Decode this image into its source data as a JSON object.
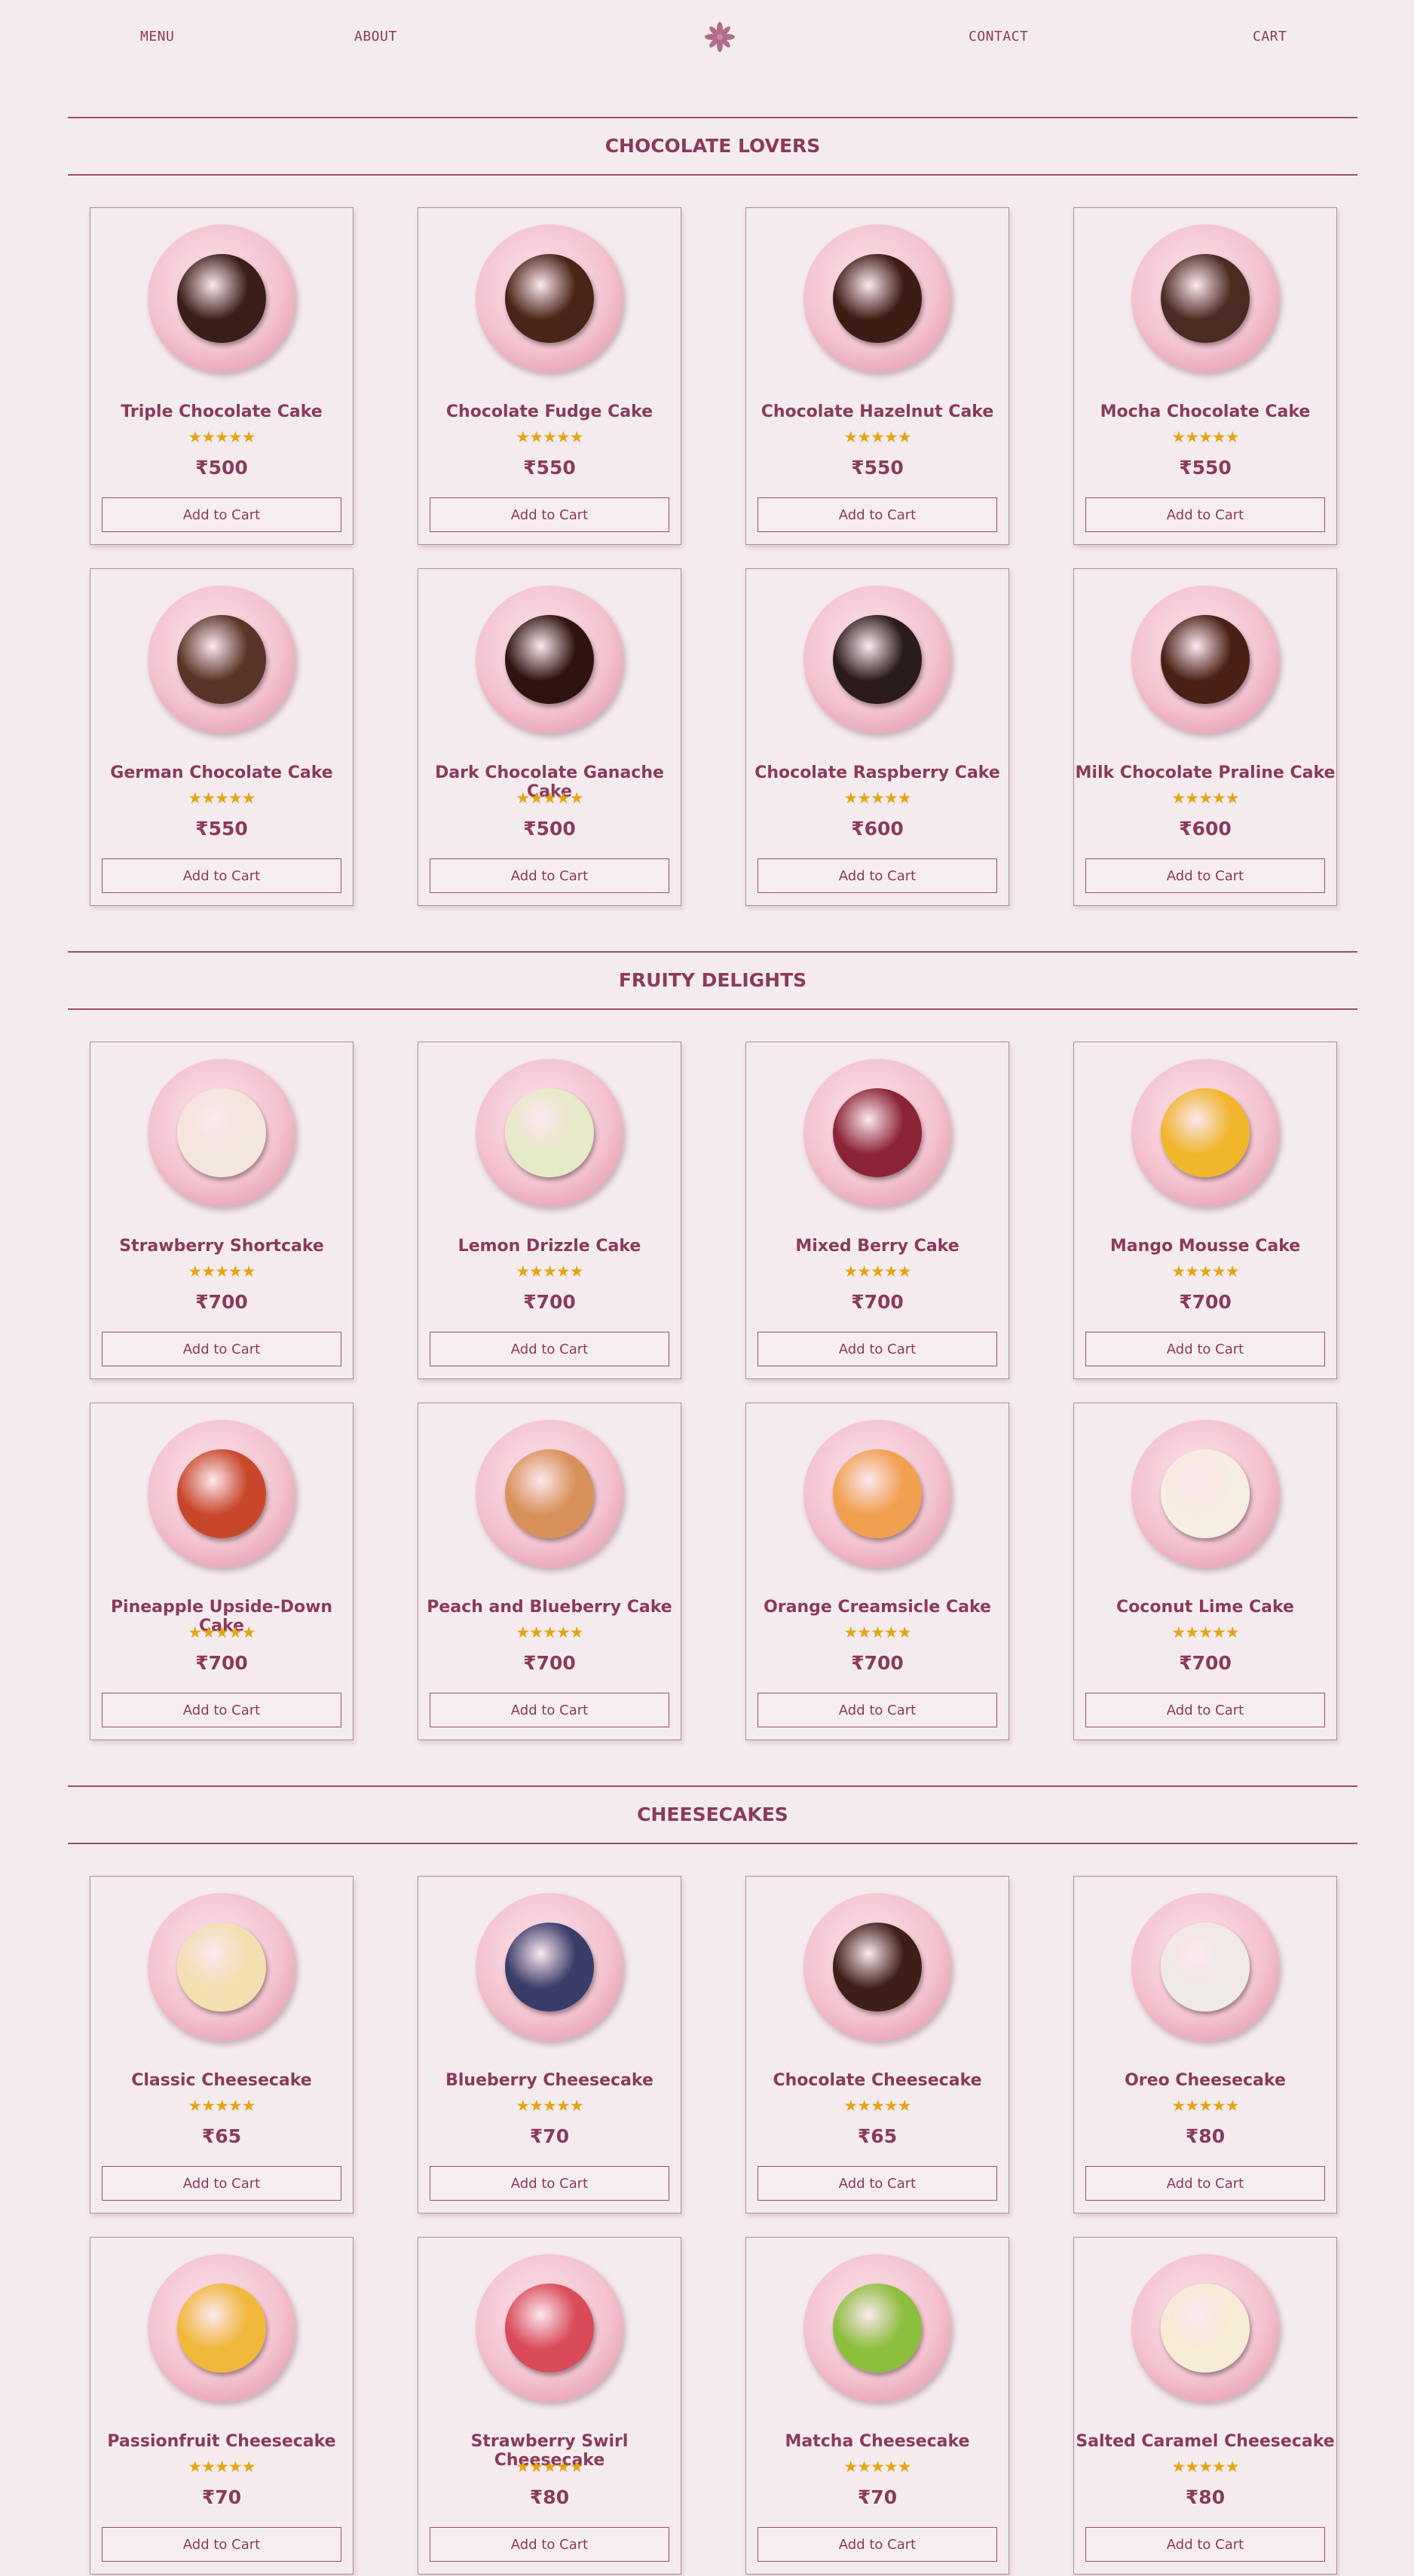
{
  "nav": {
    "menu": "MENU",
    "about": "ABOUT",
    "contact": "CONTACT",
    "cart": "CART",
    "logo_icon": "asterisk-flower-icon"
  },
  "colors": {
    "background": "#f4ebee",
    "accent": "#8a3a5c",
    "star": "#e3a514"
  },
  "rating_stars": "★★★★★",
  "add_to_cart_label": "Add to Cart",
  "sections": [
    {
      "title": "CHOCOLATE LOVERS",
      "items": [
        {
          "name": "Triple Chocolate Cake",
          "price": "₹500",
          "cake_color": "#3a1f18"
        },
        {
          "name": "Chocolate Fudge Cake",
          "price": "₹550",
          "cake_color": "#4a2418"
        },
        {
          "name": "Chocolate Hazelnut Cake",
          "price": "₹550",
          "cake_color": "#3d1c14"
        },
        {
          "name": "Mocha Chocolate Cake",
          "price": "₹550",
          "cake_color": "#4b2a22"
        },
        {
          "name": "German Chocolate Cake",
          "price": "₹550",
          "cake_color": "#5a3428"
        },
        {
          "name": "Dark Chocolate Ganache Cake",
          "price": "₹500",
          "cake_color": "#2e140f"
        },
        {
          "name": "Chocolate Raspberry Cake",
          "price": "₹600",
          "cake_color": "#2a1c1c"
        },
        {
          "name": "Milk Chocolate Praline Cake",
          "price": "₹600",
          "cake_color": "#4a2016"
        }
      ]
    },
    {
      "title": "FRUITY DELIGHTS",
      "items": [
        {
          "name": "Strawberry Shortcake",
          "price": "₹700",
          "cake_color": "#f3e6dc"
        },
        {
          "name": "Lemon Drizzle Cake",
          "price": "₹700",
          "cake_color": "#e7eac8"
        },
        {
          "name": "Mixed Berry Cake",
          "price": "₹700",
          "cake_color": "#8a2434"
        },
        {
          "name": "Mango Mousse Cake",
          "price": "₹700",
          "cake_color": "#f2b62c"
        },
        {
          "name": "Pineapple Upside-Down Cake",
          "price": "₹700",
          "cake_color": "#c8472a"
        },
        {
          "name": "Peach and Blueberry Cake",
          "price": "₹700",
          "cake_color": "#d9915a"
        },
        {
          "name": "Orange Creamsicle Cake",
          "price": "₹700",
          "cake_color": "#f1a050"
        },
        {
          "name": "Coconut Lime Cake",
          "price": "₹700",
          "cake_color": "#f6eee0"
        }
      ]
    },
    {
      "title": "CHEESECAKES",
      "items": [
        {
          "name": "Classic Cheesecake",
          "price": "₹65",
          "cake_color": "#f3e0b0"
        },
        {
          "name": "Blueberry Cheesecake",
          "price": "₹70",
          "cake_color": "#3a3c6a"
        },
        {
          "name": "Chocolate Cheesecake",
          "price": "₹65",
          "cake_color": "#3e1f18"
        },
        {
          "name": "Oreo Cheesecake",
          "price": "₹80",
          "cake_color": "#efeae6"
        },
        {
          "name": "Passionfruit Cheesecake",
          "price": "₹70",
          "cake_color": "#f1b83a"
        },
        {
          "name": "Strawberry Swirl Cheesecake",
          "price": "₹80",
          "cake_color": "#d94a5a"
        },
        {
          "name": "Matcha Cheesecake",
          "price": "₹70",
          "cake_color": "#8cbf3c"
        },
        {
          "name": "Salted Caramel Cheesecake",
          "price": "₹80",
          "cake_color": "#f7ecd6"
        }
      ]
    }
  ]
}
